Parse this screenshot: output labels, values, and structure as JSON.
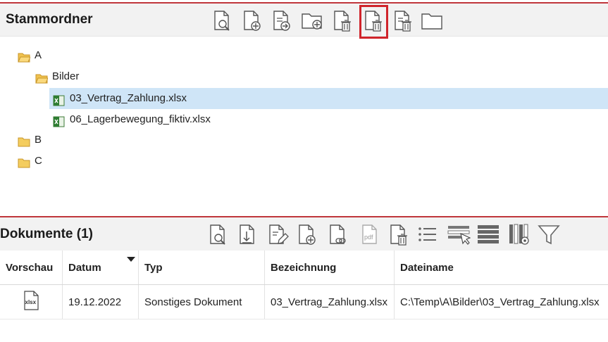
{
  "top_panel": {
    "title": "Stammordner",
    "toolbar": [
      {
        "name": "search-document-icon"
      },
      {
        "name": "add-document-icon"
      },
      {
        "name": "move-document-icon"
      },
      {
        "name": "add-folder-icon"
      },
      {
        "name": "delete-document-icon"
      },
      {
        "name": "delete-file-icon",
        "highlighted": true
      },
      {
        "name": "delete-multiple-icon"
      },
      {
        "name": "folder-icon"
      }
    ],
    "tree": [
      {
        "label": "A",
        "type": "folder-open",
        "level": 0
      },
      {
        "label": "Bilder",
        "type": "folder-open",
        "level": 1
      },
      {
        "label": "03_Vertrag_Zahlung.xlsx",
        "type": "excel",
        "level": 2,
        "selected": true
      },
      {
        "label": "06_Lagerbewegung_fiktiv.xlsx",
        "type": "excel",
        "level": 2
      },
      {
        "label": "B",
        "type": "folder",
        "level": 0
      },
      {
        "label": "C",
        "type": "folder",
        "level": 0
      }
    ]
  },
  "bottom_panel": {
    "title": "Dokumente (1)",
    "toolbar": [
      {
        "name": "search-document-icon"
      },
      {
        "name": "download-document-icon"
      },
      {
        "name": "edit-document-icon"
      },
      {
        "name": "add-document-icon"
      },
      {
        "name": "link-document-icon"
      },
      {
        "name": "pdf-icon"
      },
      {
        "name": "delete-document-icon"
      },
      {
        "name": "list-icon"
      },
      {
        "name": "select-rows-icon"
      },
      {
        "name": "rows-icon"
      },
      {
        "name": "column-settings-icon"
      },
      {
        "name": "filter-icon"
      }
    ],
    "table": {
      "columns": [
        "Vorschau",
        "Datum",
        "Typ",
        "Bezeichnung",
        "Dateiname"
      ],
      "sort_column": "Datum",
      "rows": [
        {
          "preview": "xlsx",
          "datum": "19.12.2022",
          "typ": "Sonstiges Dokument",
          "bezeichnung": "03_Vertrag_Zahlung.xlsx",
          "dateiname": "C:\\Temp\\A\\Bilder\\03_Vertrag_Zahlung.xlsx"
        }
      ]
    }
  },
  "colors": {
    "accent_red": "#c0363b",
    "highlight_box": "#d0242b",
    "selection": "#cfe5f7",
    "header_bg": "#f2f2f2"
  }
}
